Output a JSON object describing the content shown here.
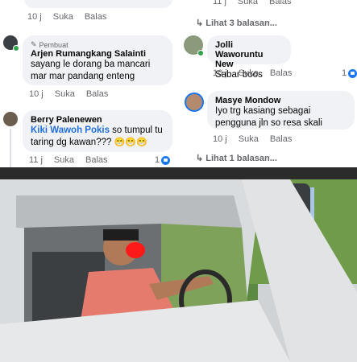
{
  "comments": [
    {
      "name": "Arjen Rumangkang Salainti",
      "creator_label": "Pembuat",
      "text": "sayang le dorang ba mancari mar mar pandang enteng",
      "time": "10 j",
      "like": "Suka",
      "reply": "Balas"
    },
    {
      "name": "Berry Palenewen",
      "mention": "Kiki Wawoh Pokis",
      "text": " so tumpul tu taring dg kawan???",
      "emoji": "😁😁😁",
      "time": "11 j",
      "like": "Suka",
      "reply": "Balas",
      "likes": "1"
    },
    {
      "name": "Jolli Waworuntu New",
      "text": "Sabar boos",
      "time": "10 j",
      "like": "Suka",
      "reply": "Balas",
      "likes": "1"
    },
    {
      "name": "Masye Mondow",
      "text": "Iyo trg kasiang sebagai pengguna jln so resa skali",
      "time": "10 j",
      "like": "Suka",
      "reply": "Balas"
    }
  ],
  "top": {
    "time": "10 j",
    "like": "Suka",
    "reply": "Balas",
    "right_time": "11 j",
    "right_like": "Suka",
    "right_reply": "Balas"
  },
  "replies": {
    "three": "Lihat 3 balasan...",
    "one": "Lihat 1 balasan..."
  }
}
